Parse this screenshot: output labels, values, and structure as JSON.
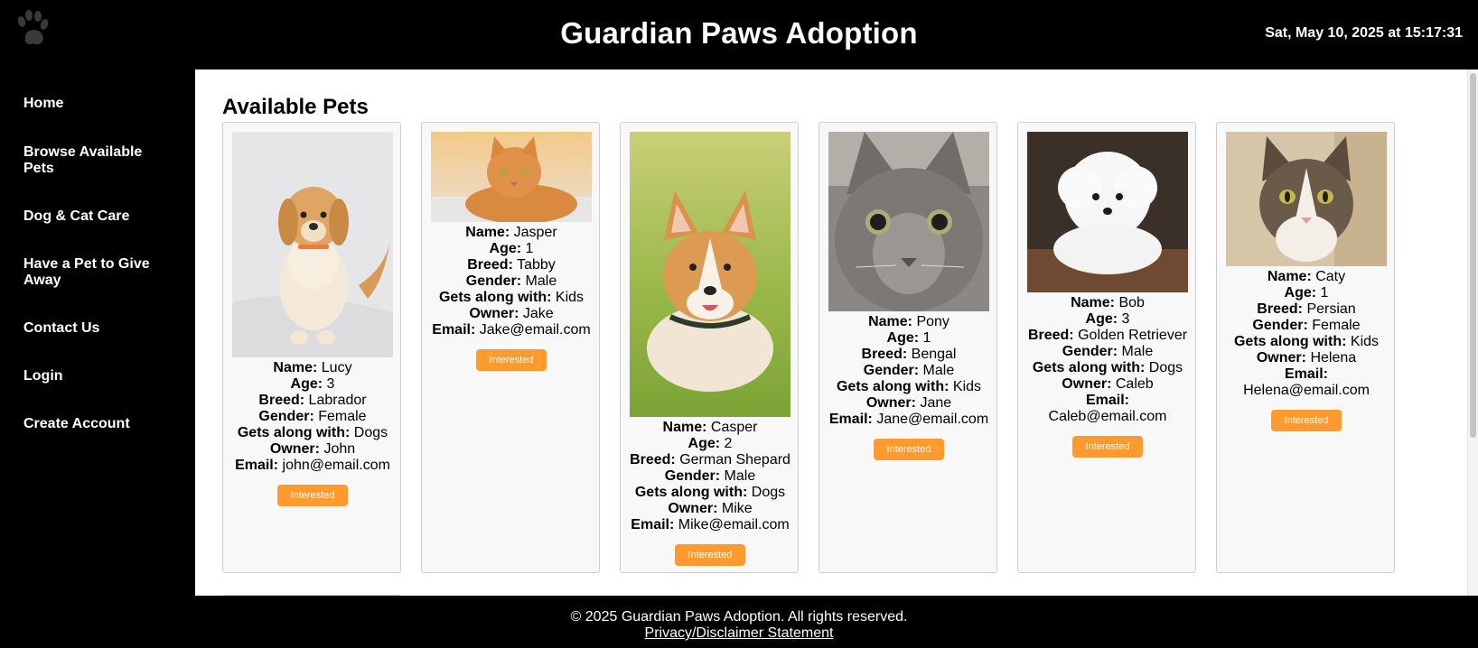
{
  "header": {
    "title": "Guardian Paws Adoption",
    "datetime": "Sat, May 10, 2025 at 15:17:31",
    "logo_icon": "paw-icon"
  },
  "nav": {
    "items": [
      {
        "label": "Home"
      },
      {
        "label": "Browse Available Pets"
      },
      {
        "label": "Dog & Cat Care"
      },
      {
        "label": "Have a Pet to Give Away"
      },
      {
        "label": "Contact Us"
      },
      {
        "label": "Login"
      },
      {
        "label": "Create Account"
      }
    ]
  },
  "main": {
    "section_title": "Available Pets",
    "field_labels": {
      "name": "Name:",
      "age": "Age:",
      "breed": "Breed:",
      "gender": "Gender:",
      "gets_along": "Gets along with:",
      "owner": "Owner:",
      "email": "Email:"
    },
    "button_label": "Interested",
    "pets": [
      {
        "name": "Lucy",
        "age": "3",
        "breed": "Labrador",
        "gender": "Female",
        "gets_along": "Dogs",
        "owner": "John",
        "email": "john@email.com"
      },
      {
        "name": "Jasper",
        "age": "1",
        "breed": "Tabby",
        "gender": "Male",
        "gets_along": "Kids",
        "owner": "Jake",
        "email": "Jake@email.com"
      },
      {
        "name": "Casper",
        "age": "2",
        "breed": "German Shepard",
        "gender": "Male",
        "gets_along": "Dogs",
        "owner": "Mike",
        "email": "Mike@email.com"
      },
      {
        "name": "Pony",
        "age": "1",
        "breed": "Bengal",
        "gender": "Male",
        "gets_along": "Kids",
        "owner": "Jane",
        "email": "Jane@email.com"
      },
      {
        "name": "Bob",
        "age": "3",
        "breed": "Golden Retriever",
        "gender": "Male",
        "gets_along": "Dogs",
        "owner": "Caleb",
        "email": "Caleb@email.com"
      },
      {
        "name": "Caty",
        "age": "1",
        "breed": "Persian",
        "gender": "Female",
        "gets_along": "Kids",
        "owner": "Helena",
        "email": "Helena@email.com"
      }
    ]
  },
  "footer": {
    "copyright": "© 2025 Guardian Paws Adoption. All rights reserved.",
    "privacy_link": "Privacy/Disclaimer Statement"
  },
  "colors": {
    "background": "#000000",
    "content_bg": "#ffffff",
    "card_bg": "#f8f8f8",
    "button": "#ff9a2e"
  }
}
